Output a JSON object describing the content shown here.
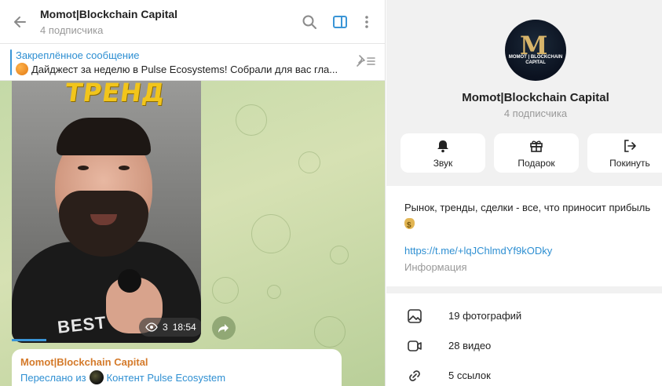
{
  "chat": {
    "title": "Momot|Blockchain Capital",
    "subtitle": "4 подписчика",
    "pinned": {
      "title": "Закреплённое сообщение",
      "text": "Дайджест за неделю в Pulse Ecosystems!  Собрали для вас гла..."
    },
    "video": {
      "overlay_text": "ТРЕНД",
      "shirt_text": "BEST WO",
      "views": "3",
      "duration": "18:54"
    },
    "message": {
      "author": "Momot|Blockchain Capital",
      "forwarded_prefix": "Переслано из",
      "forwarded_source": "Контент Pulse Ecosystem"
    }
  },
  "info": {
    "avatar_text": "MOMOT | BLOCKCHAIN CAPITAL",
    "name": "Momot|Blockchain Capital",
    "subtitle": "4 подписчика",
    "actions": [
      {
        "label": "Звук",
        "icon": "bell-icon"
      },
      {
        "label": "Подарок",
        "icon": "gift-icon"
      },
      {
        "label": "Покинуть",
        "icon": "leave-icon"
      }
    ],
    "about_text": "Рынок, тренды, сделки - все, что приносит прибыль",
    "link": "https://t.me/+lqJChlmdYf9kODky",
    "link_label": "Информация",
    "media": [
      {
        "label": "19 фотографий",
        "icon": "photo-icon"
      },
      {
        "label": "28 видео",
        "icon": "video-icon"
      },
      {
        "label": "5 ссылок",
        "icon": "link-icon"
      }
    ]
  },
  "colors": {
    "accent": "#2e8fd2",
    "author": "#d47a2a",
    "chat_bg": "#c4d9a7"
  }
}
